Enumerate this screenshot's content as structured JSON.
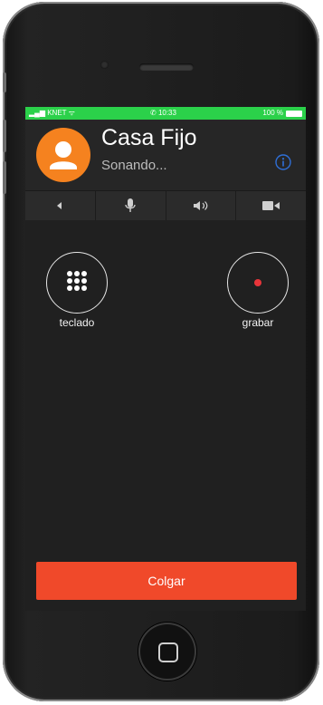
{
  "status_bar": {
    "carrier": "KNET",
    "time": "10:33",
    "battery": "100 %"
  },
  "call": {
    "contact_name": "Casa Fijo",
    "status": "Sonando..."
  },
  "controls": {
    "items": [
      {
        "icon": "back-arrow-icon"
      },
      {
        "icon": "microphone-icon"
      },
      {
        "icon": "speaker-icon"
      },
      {
        "icon": "video-camera-icon"
      }
    ]
  },
  "actions": {
    "keypad_label": "teclado",
    "record_label": "grabar"
  },
  "hangup_label": "Colgar",
  "colors": {
    "status_bar": "#2bd14a",
    "avatar": "#f5821f",
    "hangup": "#f0492a",
    "record_dot": "#e8353a",
    "info": "#2f6fd6"
  }
}
